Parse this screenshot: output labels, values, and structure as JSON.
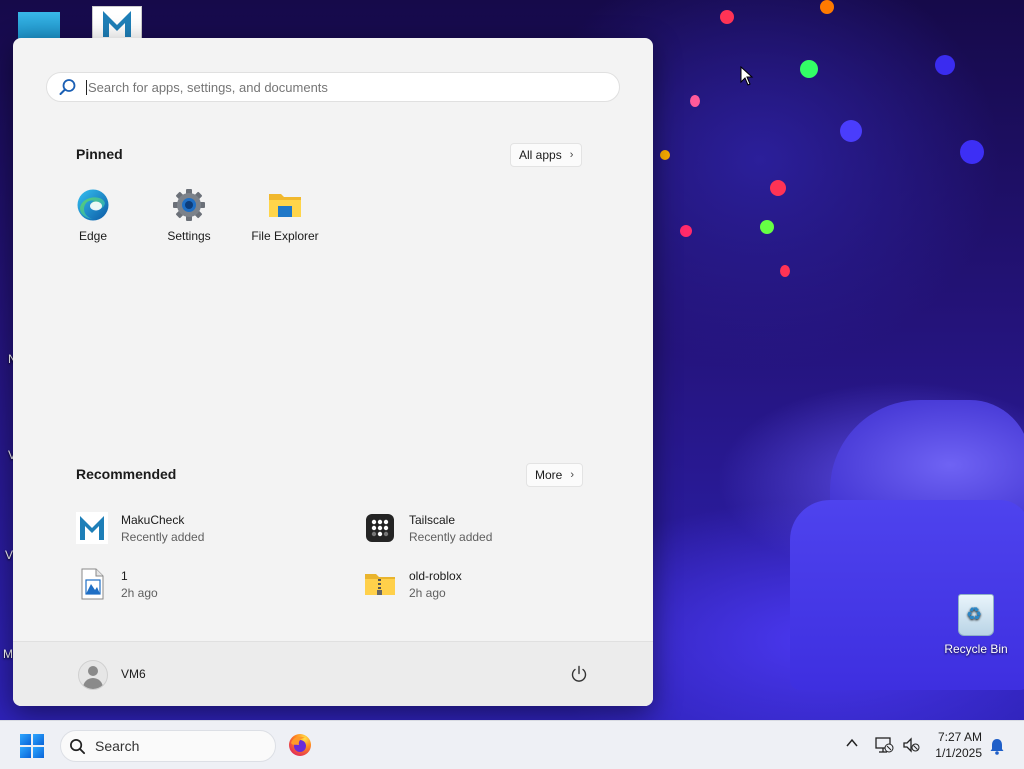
{
  "desktop": {
    "icons": [
      {
        "label": "Recycle Bin",
        "icon": "recycle-bin-icon"
      }
    ],
    "edge_letters": [
      "N",
      "V",
      "V",
      "M"
    ]
  },
  "start_menu": {
    "search": {
      "placeholder": "Search for apps, settings, and documents"
    },
    "pinned": {
      "title": "Pinned",
      "all_apps_label": "All apps",
      "items": [
        {
          "label": "Edge",
          "icon": "edge-icon"
        },
        {
          "label": "Settings",
          "icon": "settings-gear-icon"
        },
        {
          "label": "File Explorer",
          "icon": "file-explorer-icon"
        }
      ]
    },
    "recommended": {
      "title": "Recommended",
      "more_label": "More",
      "items": [
        {
          "name": "MakuCheck",
          "detail": "Recently added",
          "icon": "makucheck-icon"
        },
        {
          "name": "Tailscale",
          "detail": "Recently added",
          "icon": "tailscale-icon"
        },
        {
          "name": "1",
          "detail": "2h ago",
          "icon": "image-file-icon"
        },
        {
          "name": "old-roblox",
          "detail": "2h ago",
          "icon": "zip-folder-icon"
        }
      ]
    },
    "user": {
      "name": "VM6"
    },
    "power_icon": "power-icon"
  },
  "taskbar": {
    "search_label": "Search",
    "apps": [
      {
        "icon": "firefox-icon"
      }
    ],
    "clock": {
      "time": "7:27 AM",
      "date": "1/1/2025"
    },
    "accent_color": "#0a64d8"
  }
}
